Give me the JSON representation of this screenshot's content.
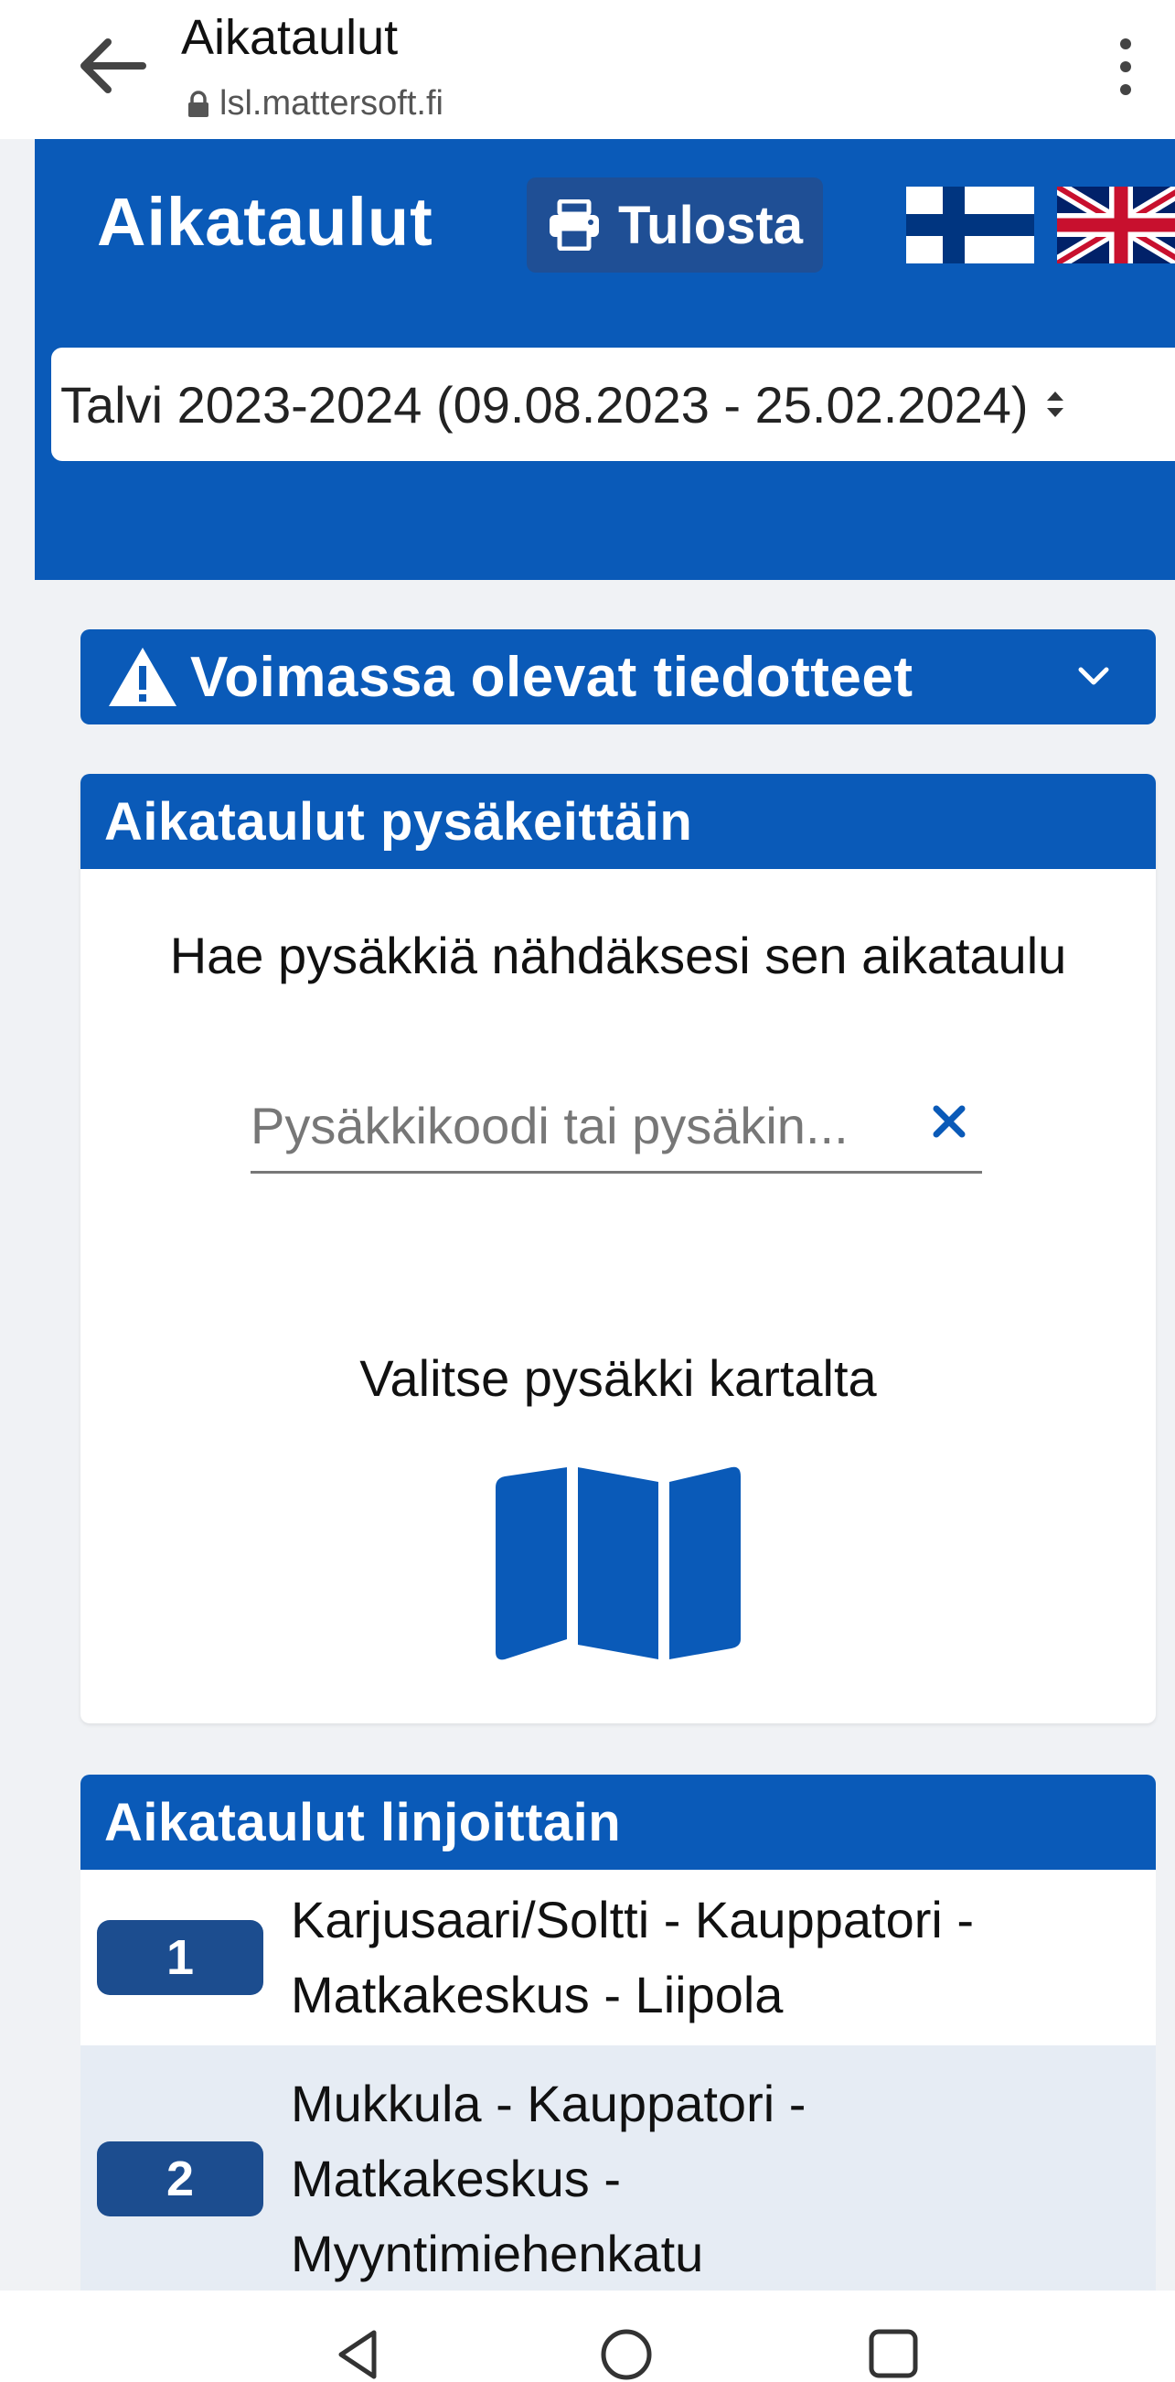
{
  "browser": {
    "title": "Aikataulut",
    "url": "lsl.mattersoft.fi",
    "icons": {
      "back": "arrow-left-icon",
      "lock": "lock-icon",
      "menu": "kebab-menu-icon"
    }
  },
  "hero": {
    "title": "Aikataulut",
    "print_label": "Tulosta",
    "languages": [
      "fi",
      "en"
    ],
    "season": "Talvi 2023-2024 (09.08.2023 - 25.02.2024)"
  },
  "notices": {
    "title": "Voimassa olevat tiedotteet"
  },
  "stops": {
    "header": "Aikataulut pysäkeittäin",
    "instruction": "Hae pysäkkiä nähdäksesi sen aikataulu",
    "search_placeholder": "Pysäkkikoodi tai pysäkin...",
    "map_label": "Valitse pysäkki kartalta"
  },
  "lines": {
    "header": "Aikataulut linjoittain",
    "items": [
      {
        "number": "1",
        "name_lines": [
          "Karjusaari/Soltti - Kauppatori -",
          "Matkakeskus - Liipola"
        ]
      },
      {
        "number": "2",
        "name_lines": [
          "Mukkula - Kauppatori -",
          "Matkakeskus -",
          "Myyntimiehenkatu"
        ]
      }
    ]
  },
  "colors": {
    "brand_blue": "#0a5ab8",
    "badge_blue": "#1c4d8f",
    "background": "#f0f2f5",
    "alt_row": "#e6ecf4"
  }
}
